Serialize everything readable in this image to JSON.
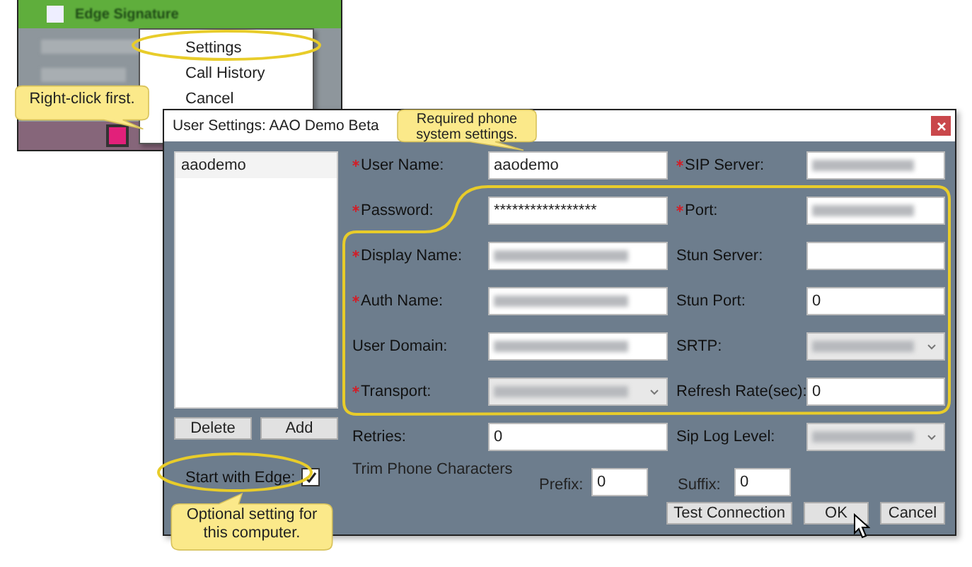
{
  "background_app": {
    "title": "Edge Signature"
  },
  "context_menu": {
    "items": [
      {
        "label": "Settings"
      },
      {
        "label": "Call History"
      },
      {
        "label": "Cancel"
      }
    ]
  },
  "callouts": [
    {
      "text": "Right-click first."
    },
    {
      "text": "Required phone system settings."
    },
    {
      "text": "Optional setting for this computer."
    }
  ],
  "dialog": {
    "title": "User Settings: AAO Demo Beta",
    "accounts": [
      "aaodemo"
    ],
    "list_buttons": [
      "Delete",
      "Add"
    ],
    "start_with_edge": {
      "label": "Start with Edge:",
      "checked": true
    },
    "fields": [
      {
        "label": "User Name:",
        "required": true,
        "kind": "text",
        "redacted": false,
        "value": "aaodemo"
      },
      {
        "label": "SIP Server:",
        "required": true,
        "kind": "text",
        "redacted": true
      },
      {
        "label": "Password:",
        "required": true,
        "kind": "text",
        "redacted": false,
        "value": "*****************"
      },
      {
        "label": "Port:",
        "required": true,
        "kind": "text",
        "redacted": true
      },
      {
        "label": "Display Name:",
        "required": true,
        "kind": "text",
        "redacted": true
      },
      {
        "label": "Stun Server:",
        "required": false,
        "kind": "text",
        "redacted": false
      },
      {
        "label": "Auth Name:",
        "required": true,
        "kind": "text",
        "redacted": true
      },
      {
        "label": "Stun Port:",
        "required": false,
        "kind": "text",
        "redacted": false,
        "value": "0"
      },
      {
        "label": "User Domain:",
        "required": false,
        "kind": "text",
        "redacted": true
      },
      {
        "label": "SRTP:",
        "required": false,
        "kind": "select",
        "redacted": true
      },
      {
        "label": "Transport:",
        "required": true,
        "kind": "select",
        "redacted": true
      },
      {
        "label": "Refresh Rate(sec):",
        "required": false,
        "kind": "text",
        "redacted": false,
        "value": "0"
      },
      {
        "label": "Retries:",
        "required": false,
        "kind": "text",
        "redacted": false,
        "value": "0"
      },
      {
        "label": "Sip Log Level:",
        "required": false,
        "kind": "select",
        "redacted": true
      }
    ],
    "trim": {
      "label": "Trim Phone Characters",
      "prefix": {
        "label": "Prefix:",
        "value": "0"
      },
      "suffix": {
        "label": "Suffix:",
        "value": "0"
      }
    },
    "buttons": [
      "Test Connection",
      "OK",
      "Cancel"
    ]
  }
}
